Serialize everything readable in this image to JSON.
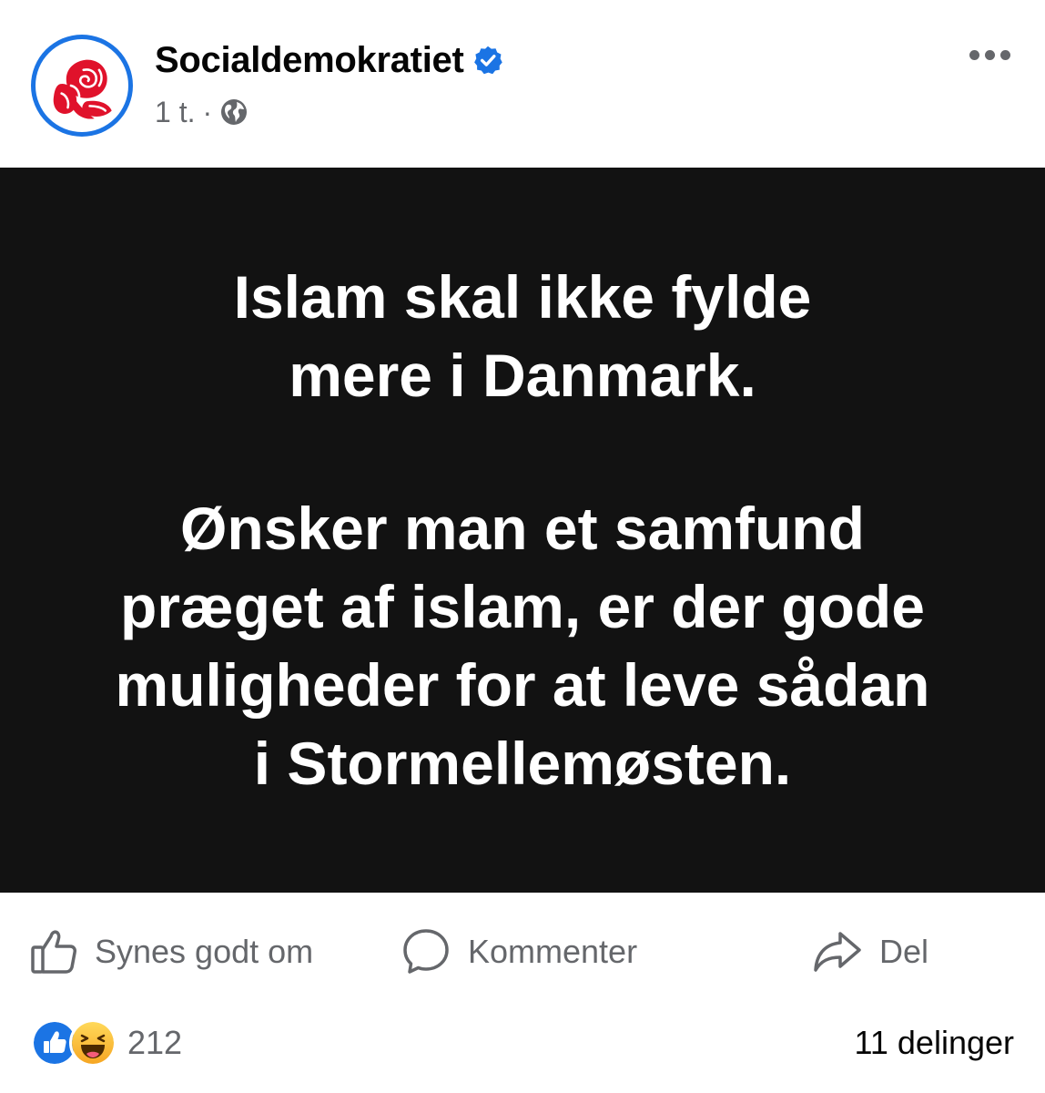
{
  "post": {
    "page_name": "Socialdemokratiet",
    "timestamp": "1 t.",
    "separator": "·",
    "verified_icon": "verified-badge-icon",
    "audience_icon": "globe-icon",
    "avatar_icon": "red-rose-icon",
    "more_icon": "more-options-icon"
  },
  "media": {
    "paragraphs": [
      [
        "Islam skal ikke fylde",
        "mere i Danmark."
      ],
      [
        "Ønsker man et samfund",
        "præget af islam, er der gode",
        "muligheder for at leve sådan",
        "i Stormellemøsten."
      ]
    ]
  },
  "actions": {
    "like_label": "Synes godt om",
    "comment_label": "Kommenter",
    "share_label": "Del"
  },
  "footer": {
    "reaction_count": "212",
    "share_count": "11 delinger"
  },
  "colors": {
    "brand_blue": "#1b74e4",
    "rose_red": "#e0122b",
    "media_background": "#121212",
    "secondary_text": "#65676b"
  }
}
